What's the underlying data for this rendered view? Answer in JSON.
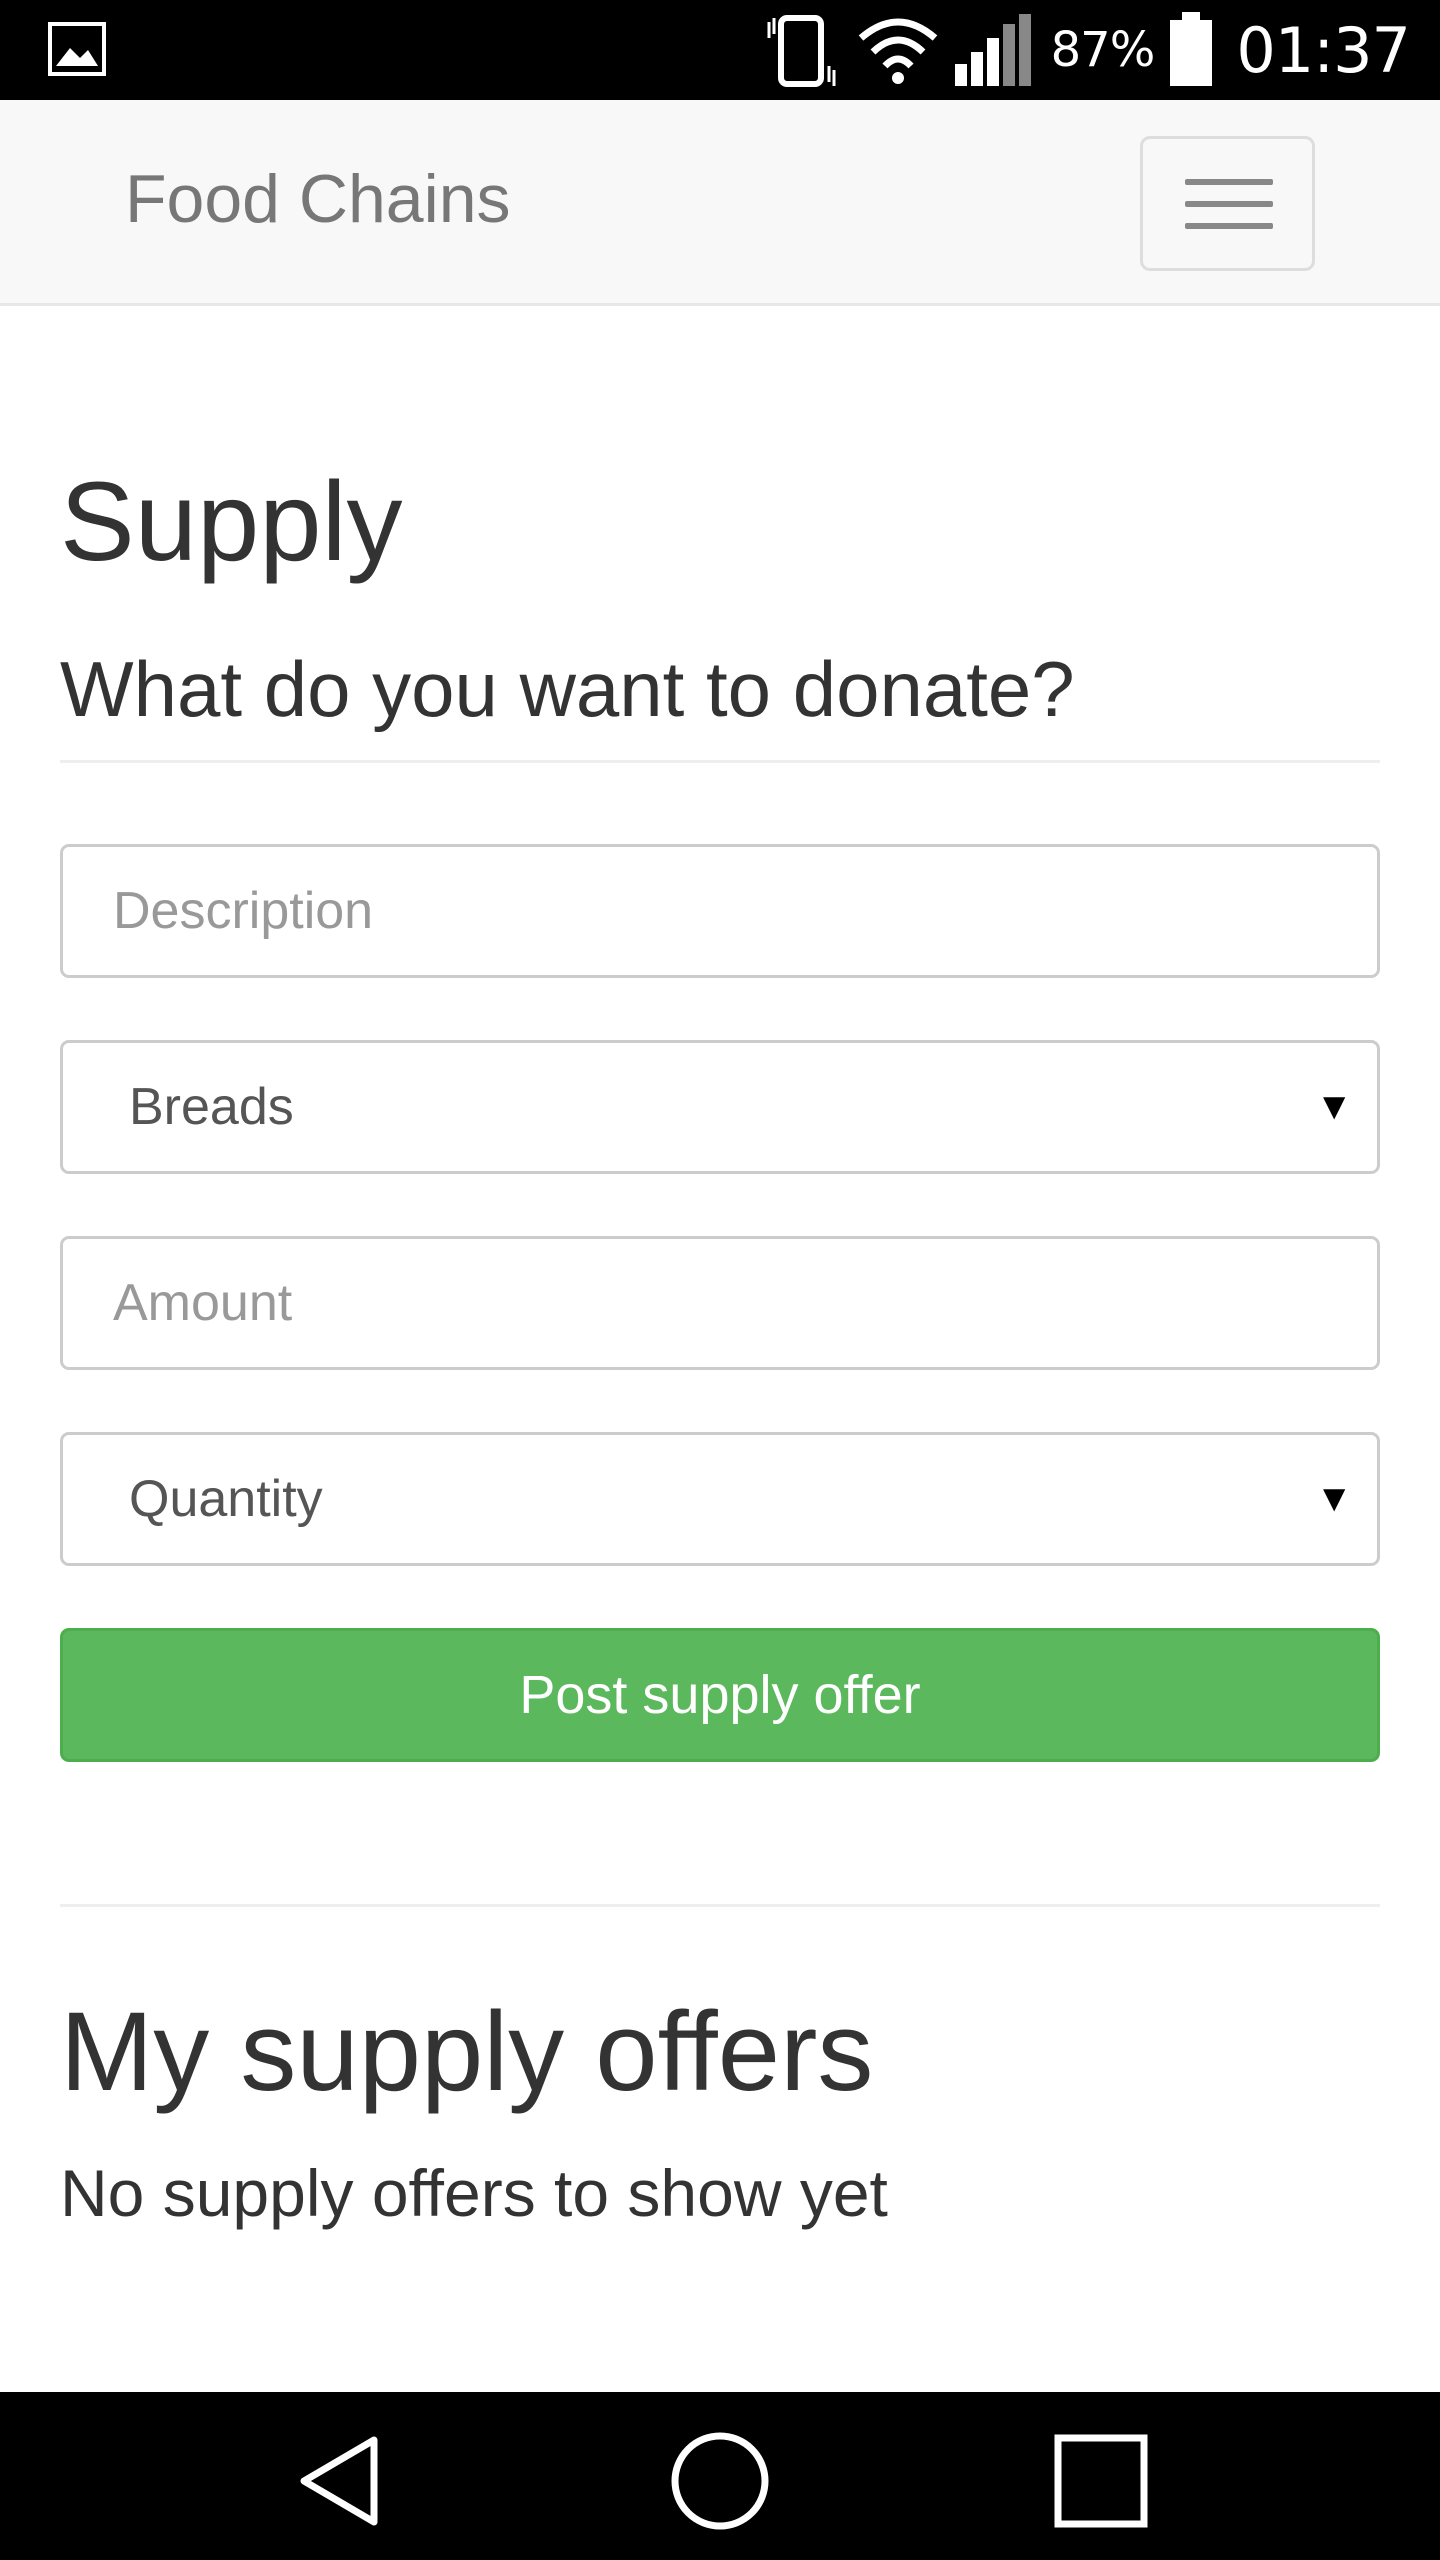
{
  "status_bar": {
    "battery_percent": "87%",
    "time": "01:37",
    "icons": [
      "gallery-icon",
      "vibrate-icon",
      "wifi-icon",
      "signal-icon",
      "battery-icon"
    ]
  },
  "navbar": {
    "brand": "Food Chains",
    "toggle_icon": "hamburger-menu-icon"
  },
  "page": {
    "title": "Supply",
    "subtitle": "What do you want to donate?"
  },
  "form": {
    "description_placeholder": "Description",
    "category_selected": "Breads",
    "amount_placeholder": "Amount",
    "quantity_selected": "Quantity",
    "submit_label": "Post supply offer",
    "submit_color": "#5cb85c"
  },
  "offers": {
    "heading": "My supply offers",
    "empty_text": "No supply offers to show yet"
  },
  "nav_keys": [
    "back-icon",
    "home-icon",
    "recent-apps-icon"
  ]
}
